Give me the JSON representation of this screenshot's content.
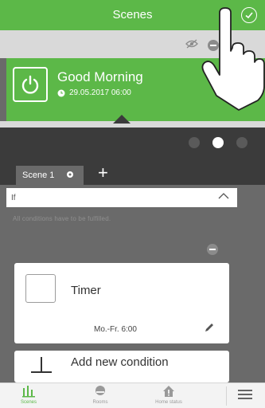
{
  "header": {
    "title": "Scenes"
  },
  "scene": {
    "name": "Good Morning",
    "datetime": "29.05.2017   06:00"
  },
  "tabs": [
    {
      "label": "Scene 1"
    }
  ],
  "section": {
    "title": "If",
    "hint": "All conditions have to be fulfilled."
  },
  "conditions": [
    {
      "title": "Timer",
      "schedule": "Mo.-Fr. 6:00"
    },
    {
      "title": "Add new condition"
    }
  ],
  "nav": [
    {
      "label": "Scenes"
    },
    {
      "label": "Rooms"
    },
    {
      "label": "Home status"
    }
  ],
  "colors": {
    "accent": "#5cb848",
    "dark": "#3b3b3b",
    "panel": "#6a6a6a"
  }
}
